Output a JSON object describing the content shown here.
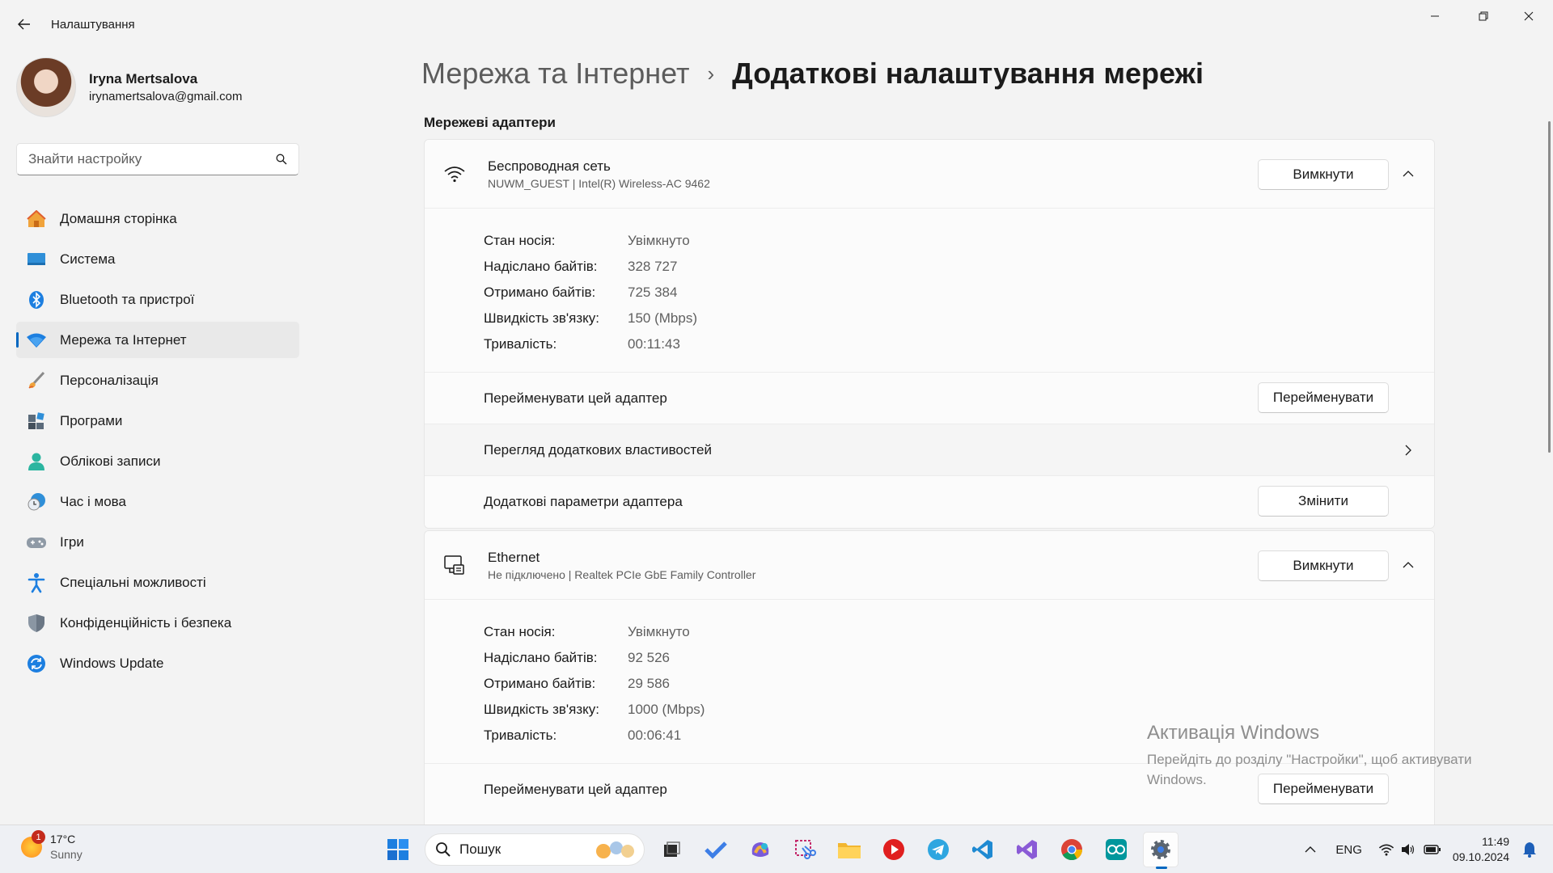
{
  "window": {
    "title": "Налаштування"
  },
  "profile": {
    "name": "Iryna Mertsalova",
    "email": "irynamertsalova@gmail.com"
  },
  "search": {
    "placeholder": "Знайти настройку"
  },
  "nav": {
    "items": [
      {
        "label": "Домашня сторінка",
        "icon": "home-icon"
      },
      {
        "label": "Система",
        "icon": "system-icon"
      },
      {
        "label": "Bluetooth та пристрої",
        "icon": "bluetooth-icon"
      },
      {
        "label": "Мережа та Інтернет",
        "icon": "network-icon",
        "active": true
      },
      {
        "label": "Персоналізація",
        "icon": "brush-icon"
      },
      {
        "label": "Програми",
        "icon": "apps-icon"
      },
      {
        "label": "Облікові записи",
        "icon": "accounts-icon"
      },
      {
        "label": "Час і мова",
        "icon": "time-language-icon"
      },
      {
        "label": "Ігри",
        "icon": "gamepad-icon"
      },
      {
        "label": "Спеціальні можливості",
        "icon": "accessibility-icon"
      },
      {
        "label": "Конфіденційність і безпека",
        "icon": "shield-icon"
      },
      {
        "label": "Windows Update",
        "icon": "update-icon"
      }
    ]
  },
  "breadcrumb": {
    "parent": "Мережа та Інтернет",
    "separator": "›",
    "current": "Додаткові налаштування мережі"
  },
  "section_title": "Мережеві адаптери",
  "adapters": [
    {
      "name": "Беспроводная сеть",
      "subtitle": "NUWM_GUEST | Intel(R) Wireless-AC 9462",
      "toggle_label": "Вимкнути",
      "details": [
        {
          "label": "Стан носія:",
          "value": "Увімкнуто"
        },
        {
          "label": "Надіслано байтів:",
          "value": "328 727"
        },
        {
          "label": "Отримано байтів:",
          "value": "725 384"
        },
        {
          "label": "Швидкість зв'язку:",
          "value": "150 (Mbps)"
        },
        {
          "label": "Тривалість:",
          "value": "00:11:43"
        }
      ],
      "rename_label": "Перейменувати цей адаптер",
      "rename_button": "Перейменувати",
      "properties_label": "Перегляд додаткових властивостей",
      "options_label": "Додаткові параметри адаптера",
      "options_button": "Змінити"
    },
    {
      "name": "Ethernet",
      "subtitle": "Не підключено | Realtek PCIe GbE Family Controller",
      "toggle_label": "Вимкнути",
      "details": [
        {
          "label": "Стан носія:",
          "value": "Увімкнуто"
        },
        {
          "label": "Надіслано байтів:",
          "value": "92 526"
        },
        {
          "label": "Отримано байтів:",
          "value": "29 586"
        },
        {
          "label": "Швидкість зв'язку:",
          "value": "1000 (Mbps)"
        },
        {
          "label": "Тривалість:",
          "value": "00:06:41"
        }
      ],
      "rename_label": "Перейменувати цей адаптер",
      "rename_button": "Перейменувати"
    }
  ],
  "watermark": {
    "title": "Активація Windows",
    "text": "Перейдіть до розділу \"Настройки\", щоб активувати Windows."
  },
  "taskbar": {
    "weather_temp": "17°C",
    "weather_cond": "Sunny",
    "weather_badge": "1",
    "search_label": "Пошук",
    "language": "ENG",
    "time": "11:49",
    "date": "09.10.2024"
  },
  "colors": {
    "accent": "#0067c0"
  }
}
